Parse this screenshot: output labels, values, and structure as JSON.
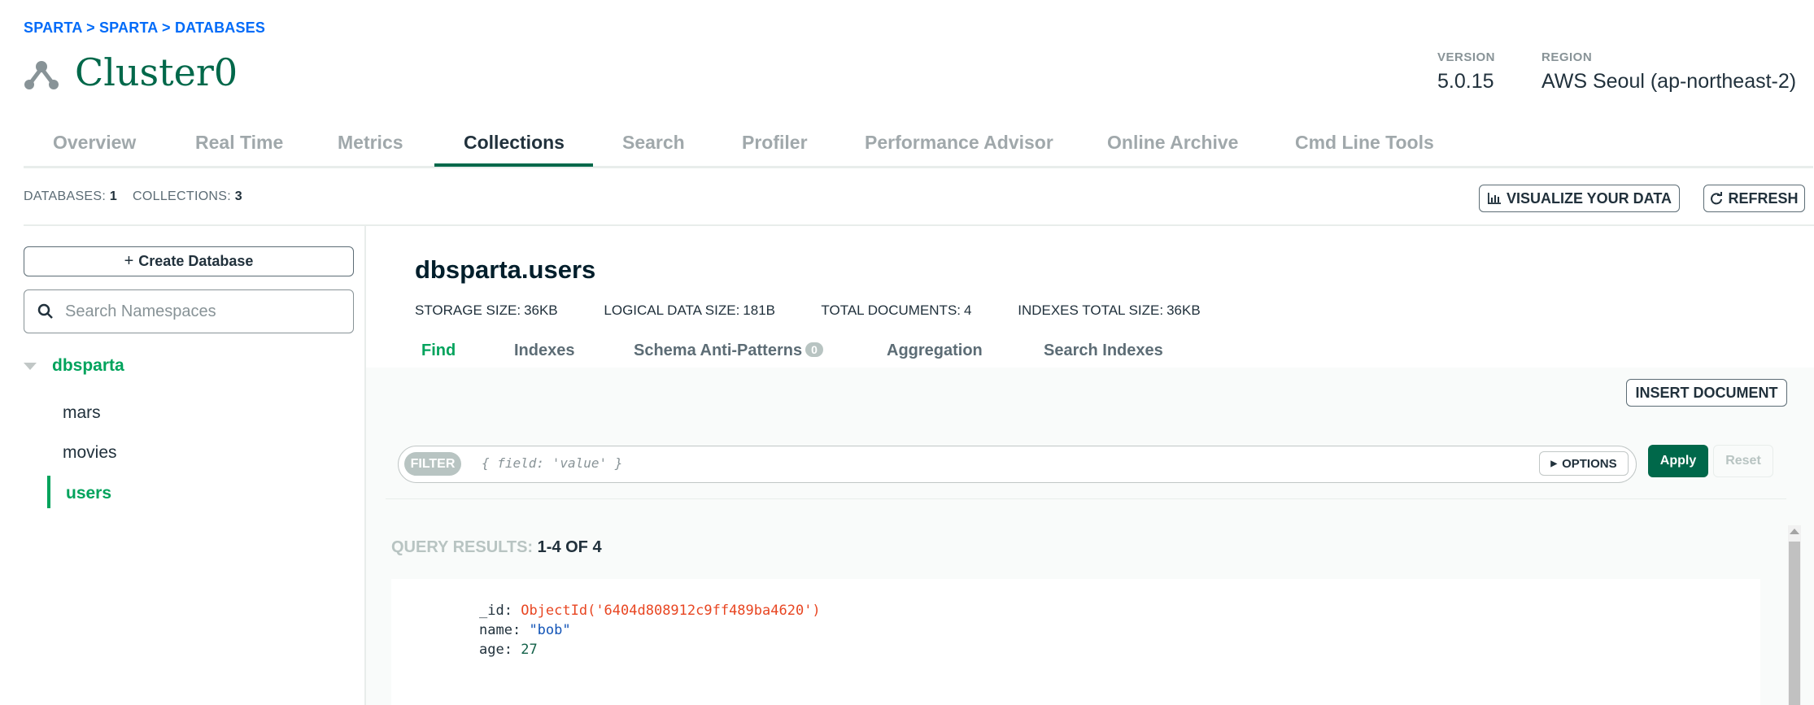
{
  "breadcrumb": "SPARTA > SPARTA > DATABASES",
  "cluster": {
    "name": "Cluster0",
    "icon": "cluster-icon"
  },
  "meta": {
    "version_label": "VERSION",
    "version_value": "5.0.15",
    "region_label": "REGION",
    "region_value": "AWS Seoul (ap-northeast-2)"
  },
  "tabs": [
    "Overview",
    "Real Time",
    "Metrics",
    "Collections",
    "Search",
    "Profiler",
    "Performance Advisor",
    "Online Archive",
    "Cmd Line Tools"
  ],
  "active_tab": "Collections",
  "counts": {
    "databases_label": "DATABASES:",
    "databases_value": "1",
    "collections_label": "COLLECTIONS:",
    "collections_value": "3"
  },
  "toolbar": {
    "visualize_label": "VISUALIZE YOUR DATA",
    "refresh_label": "REFRESH"
  },
  "sidebar": {
    "create_db_label": "Create Database",
    "search_placeholder": "Search Namespaces",
    "database": "dbsparta",
    "collections": [
      "mars",
      "movies",
      "users"
    ],
    "active_collection": "users"
  },
  "namespace": {
    "title": "dbsparta.users",
    "stats": {
      "storage_label": "STORAGE SIZE:",
      "storage_value": "36KB",
      "logical_label": "LOGICAL DATA SIZE:",
      "logical_value": "181B",
      "docs_label": "TOTAL DOCUMENTS:",
      "docs_value": "4",
      "indexes_label": "INDEXES TOTAL SIZE:",
      "indexes_value": "36KB"
    }
  },
  "subtabs": {
    "find": "Find",
    "indexes": "Indexes",
    "schema": "Schema Anti-Patterns",
    "schema_count": "0",
    "aggregation": "Aggregation",
    "search_indexes": "Search Indexes"
  },
  "actions": {
    "insert_label": "INSERT DOCUMENT",
    "filter_pill": "FILTER",
    "filter_placeholder": "{ field: 'value' }",
    "options_label": "OPTIONS",
    "apply_label": "Apply",
    "reset_label": "Reset"
  },
  "results": {
    "label": "QUERY RESULTS:",
    "range": "1-4 OF 4"
  },
  "document": {
    "id_key": "_id:",
    "id_value": "ObjectId('6404d808912c9ff489ba4620')",
    "name_key": "name:",
    "name_value": "\"bob\"",
    "age_key": "age:",
    "age_value": "27"
  },
  "colors": {
    "brand_green": "#00684a",
    "accent_green": "#00a35c",
    "link_blue": "#016bf8"
  }
}
